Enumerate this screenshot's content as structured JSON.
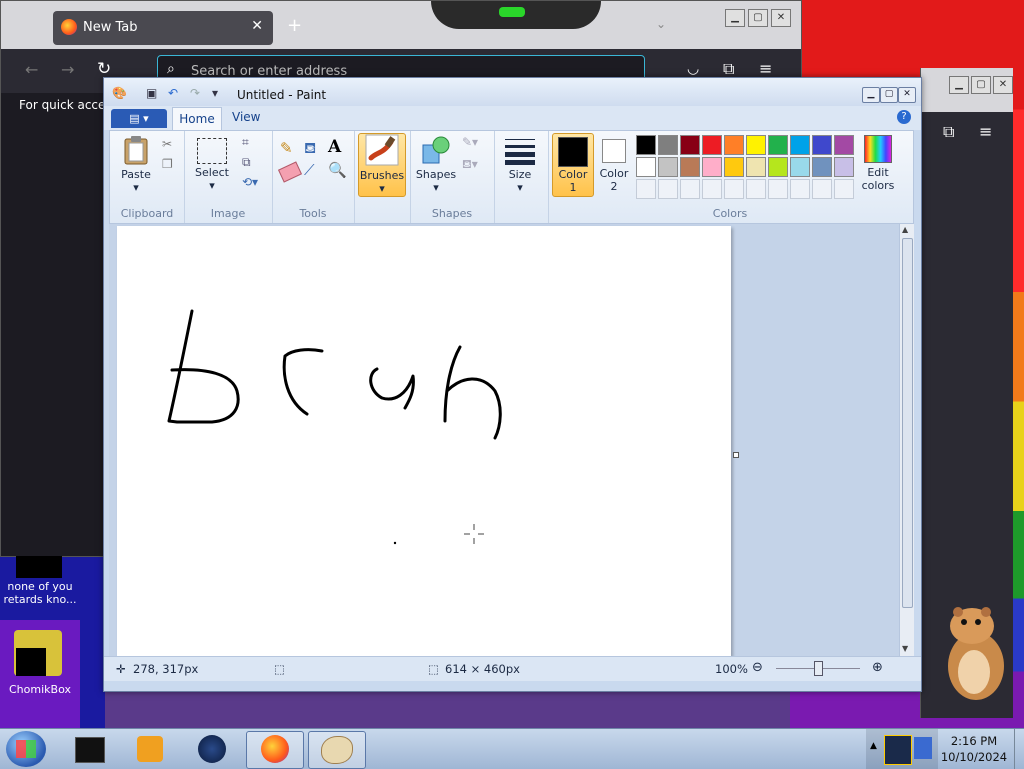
{
  "firefox": {
    "tab_title": "New Tab",
    "tab_close": "✕",
    "new_tab": "+",
    "address_placeholder": "Search or enter address",
    "bookmarks_text": "For quick access"
  },
  "paint": {
    "window_title": "Untitled - Paint",
    "tabs": {
      "file": "▤ ▾",
      "home": "Home",
      "view": "View",
      "help": "?"
    },
    "groups": {
      "clipboard": "Clipboard",
      "image": "Image",
      "tools": "Tools",
      "shapes": "Shapes",
      "colors": "Colors"
    },
    "buttons": {
      "paste": "Paste",
      "select": "Select",
      "brushes": "Brushes",
      "shapes": "Shapes",
      "size": "Size",
      "color1_a": "Color",
      "color1_b": "1",
      "color2_a": "Color",
      "color2_b": "2",
      "edit_colors_a": "Edit",
      "edit_colors_b": "colors",
      "text_tool": "A"
    },
    "palette_row1": [
      "#000000",
      "#7f7f7f",
      "#880015",
      "#ed1c24",
      "#ff7f27",
      "#fff200",
      "#22b14c",
      "#00a2e8",
      "#3f48cc",
      "#a349a4"
    ],
    "palette_row2": [
      "#ffffff",
      "#c3c3c3",
      "#b97a57",
      "#ffaec9",
      "#ffc90e",
      "#efe4b0",
      "#b5e61d",
      "#99d9ea",
      "#7092be",
      "#c8bfe7"
    ],
    "color1": "#000000",
    "color2": "#ffffff",
    "status": {
      "cursor_pos": "278, 317px",
      "canvas_size": "614 × 460px",
      "zoom": "100%"
    }
  },
  "desktop": {
    "icon1_label": "none of you retards kno...",
    "icon2_label": "ChomikBox"
  },
  "taskbar": {
    "time": "2:16 PM",
    "date": "10/10/2024"
  }
}
